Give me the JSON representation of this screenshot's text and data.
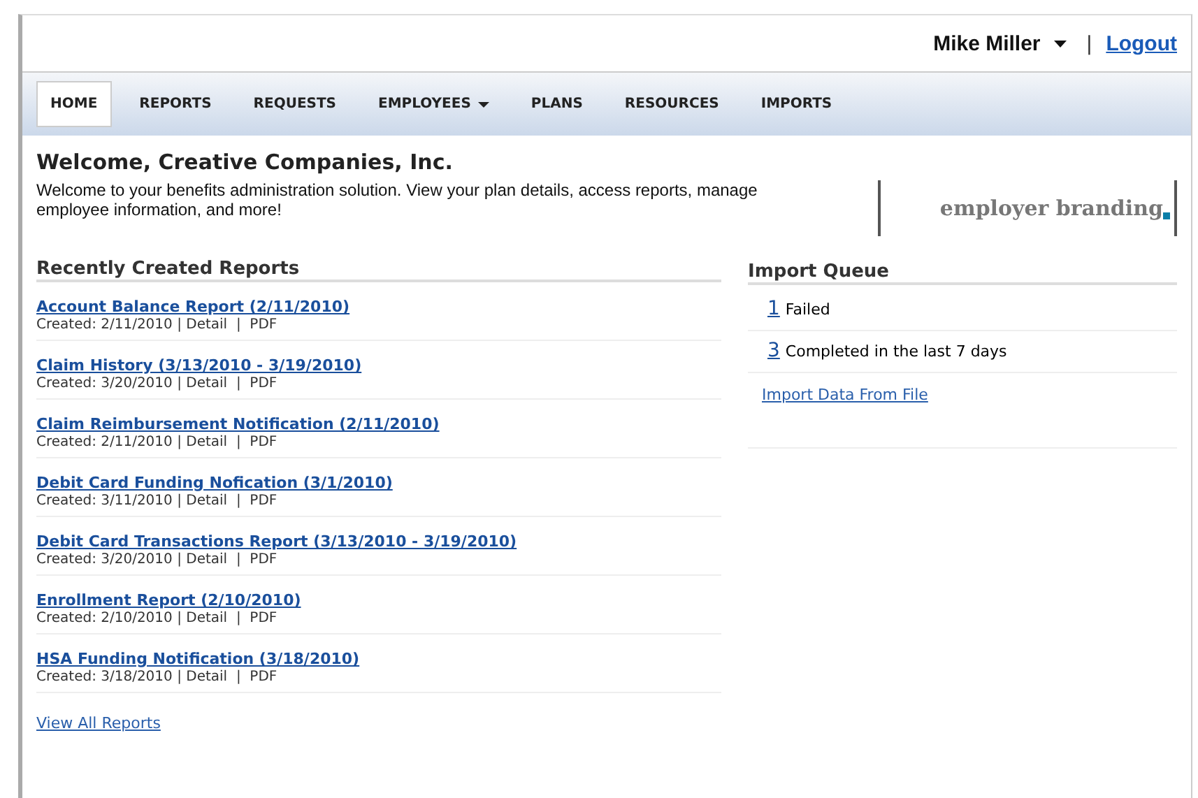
{
  "user_menu": {
    "name": "Mike Miller",
    "separator": "|",
    "logout": "Logout"
  },
  "nav": [
    {
      "label": "HOME",
      "selected": true,
      "dropdown": false
    },
    {
      "label": "REPORTS",
      "selected": false,
      "dropdown": false
    },
    {
      "label": "REQUESTS",
      "selected": false,
      "dropdown": false
    },
    {
      "label": "EMPLOYEES",
      "selected": false,
      "dropdown": true
    },
    {
      "label": "PLANS",
      "selected": false,
      "dropdown": false
    },
    {
      "label": "RESOURCES",
      "selected": false,
      "dropdown": false
    },
    {
      "label": "IMPORTS",
      "selected": false,
      "dropdown": false
    }
  ],
  "welcome": {
    "title": "Welcome, Creative Companies, Inc.",
    "text": "Welcome to your benefits administration solution. View your plan details, access reports, manage employee information, and more!",
    "branding": "employer branding"
  },
  "reports": {
    "title": "Recently Created Reports",
    "items": [
      {
        "name": "Account Balance Report (2/11/2010)",
        "meta": "Created: 2/11/2010 | Detail  |  PDF"
      },
      {
        "name": "Claim History (3/13/2010 - 3/19/2010)",
        "meta": "Created: 3/20/2010 | Detail  |  PDF"
      },
      {
        "name": "Claim Reimbursement Notification (2/11/2010)",
        "meta": "Created: 2/11/2010 | Detail  |  PDF"
      },
      {
        "name": "Debit Card Funding Nofication (3/1/2010)",
        "meta": "Created: 3/11/2010 | Detail  |  PDF"
      },
      {
        "name": "Debit Card Transactions Report (3/13/2010 - 3/19/2010)",
        "meta": "Created: 3/20/2010 | Detail  |  PDF"
      },
      {
        "name": "Enrollment Report (2/10/2010)",
        "meta": "Created: 2/10/2010 | Detail  |  PDF"
      },
      {
        "name": "HSA Funding Notification (3/18/2010)",
        "meta": "Created: 3/18/2010 | Detail  |  PDF"
      }
    ],
    "view_all": "View All Reports"
  },
  "import_queue": {
    "title": "Import Queue",
    "items": [
      {
        "count": "1",
        "label": "Failed"
      },
      {
        "count": "3",
        "label": "Completed in the last 7 days"
      }
    ],
    "import_link": "Import Data From File"
  }
}
